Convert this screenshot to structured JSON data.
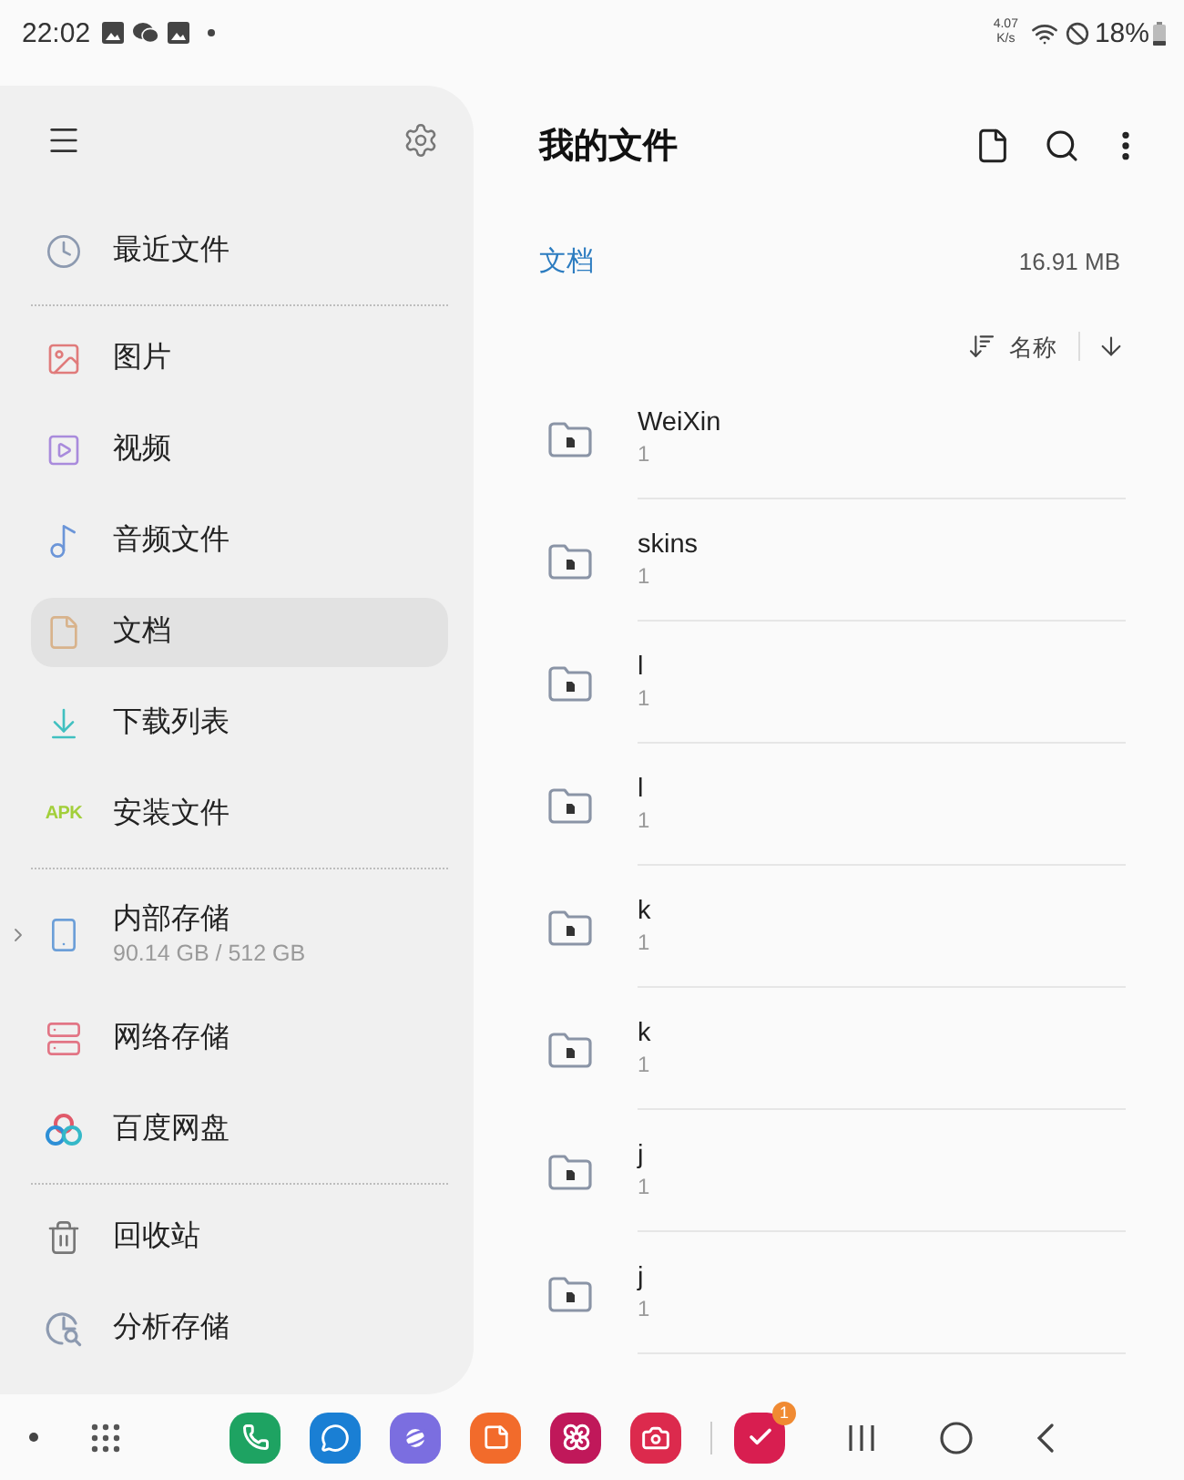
{
  "status_bar": {
    "time": "22:02",
    "speed": "4.07",
    "speed_unit": "K/s",
    "battery": "18%"
  },
  "sidebar": {
    "groups": [
      {
        "items": [
          {
            "label": "最近文件",
            "selected": false
          }
        ]
      },
      {
        "items": [
          {
            "label": "图片",
            "selected": false
          },
          {
            "label": "视频",
            "selected": false
          },
          {
            "label": "音频文件",
            "selected": false
          },
          {
            "label": "文档",
            "selected": true
          },
          {
            "label": "下载列表",
            "selected": false
          },
          {
            "label": "安装文件",
            "selected": false,
            "icon_text": "APK"
          }
        ]
      },
      {
        "items": [
          {
            "label": "内部存储",
            "selected": false,
            "detail": "90.14 GB / 512 GB",
            "expanded": false
          },
          {
            "label": "网络存储",
            "selected": false
          },
          {
            "label": "百度网盘",
            "selected": false
          }
        ]
      },
      {
        "items": [
          {
            "label": "回收站",
            "selected": false
          },
          {
            "label": "分析存储",
            "selected": false
          }
        ]
      }
    ]
  },
  "header": {
    "title": "我的文件"
  },
  "location": {
    "folder": "文档",
    "size": "16.91 MB"
  },
  "sort": {
    "label": "名称"
  },
  "files": [
    {
      "name": "WeiXin",
      "count": "1"
    },
    {
      "name": "skins",
      "count": "1"
    },
    {
      "name": "l",
      "count": "1"
    },
    {
      "name": "l",
      "count": "1"
    },
    {
      "name": "k",
      "count": "1"
    },
    {
      "name": "k",
      "count": "1"
    },
    {
      "name": "j",
      "count": "1"
    },
    {
      "name": "j",
      "count": "1"
    }
  ],
  "taskbar": {
    "badge": "1"
  }
}
